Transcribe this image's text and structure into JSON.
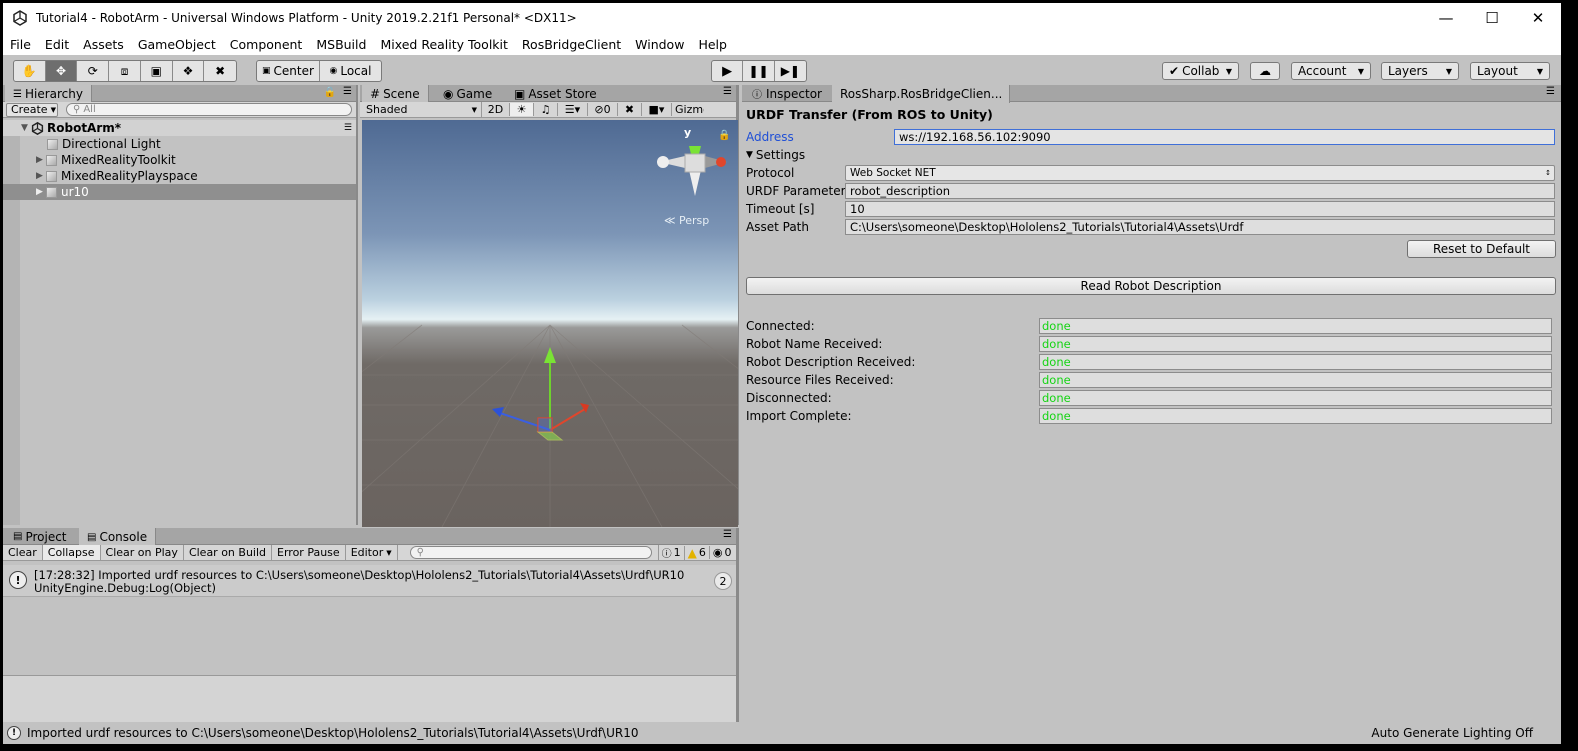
{
  "window": {
    "title": "Tutorial4 - RobotArm - Universal Windows Platform - Unity 2019.2.21f1 Personal* <DX11>"
  },
  "menu": [
    "File",
    "Edit",
    "Assets",
    "GameObject",
    "Component",
    "MSBuild",
    "Mixed Reality Toolkit",
    "RosBridgeClient",
    "Window",
    "Help"
  ],
  "toolbar": {
    "pivot": "Center",
    "space": "Local",
    "collab": "Collab",
    "account": "Account",
    "layers": "Layers",
    "layout": "Layout"
  },
  "hierarchy": {
    "tab": "Hierarchy",
    "create": "Create",
    "search_placeholder": "All",
    "scene": "RobotArm*",
    "items": [
      "Directional Light",
      "MixedRealityToolkit",
      "MixedRealityPlayspace",
      "ur10"
    ]
  },
  "scene_view": {
    "tabs": [
      "Scene",
      "Game",
      "Asset Store"
    ],
    "shading": "Shaded",
    "mode_2d": "2D",
    "fx_count": "0",
    "gizmos": "Gizmo",
    "gizmo_axis_y": "y",
    "persp": "Persp"
  },
  "inspector": {
    "tabs": [
      "Inspector",
      "RosSharp.RosBridgeClien..."
    ],
    "header": "URDF Transfer (From ROS to Unity)",
    "address_label": "Address",
    "address_value": "ws://192.168.56.102:9090",
    "settings_label": "Settings",
    "protocol_label": "Protocol",
    "protocol_value": "Web Socket NET",
    "urdf_param_label": "URDF Parameter",
    "urdf_param_value": "robot_description",
    "timeout_label": "Timeout [s]",
    "timeout_value": "10",
    "asset_path_label": "Asset Path",
    "asset_path_value": "C:\\Users\\someone\\Desktop\\Hololens2_Tutorials\\Tutorial4\\Assets\\Urdf",
    "reset_button": "Reset to Default",
    "read_button": "Read Robot Description",
    "status": [
      {
        "label": "Connected:",
        "value": "done"
      },
      {
        "label": "Robot Name Received:",
        "value": "done"
      },
      {
        "label": "Robot Description Received:",
        "value": "done"
      },
      {
        "label": "Resource Files Received:",
        "value": "done"
      },
      {
        "label": "Disconnected:",
        "value": "done"
      },
      {
        "label": "Import Complete:",
        "value": "done"
      }
    ]
  },
  "console": {
    "tabs": [
      "Project",
      "Console"
    ],
    "buttons": [
      "Clear",
      "Collapse",
      "Clear on Play",
      "Clear on Build",
      "Error Pause",
      "Editor"
    ],
    "info_count": "1",
    "warn_count": "6",
    "error_count": "0",
    "entry_line1": "[17:28:32] Imported urdf resources to C:\\Users\\someone\\Desktop\\Hololens2_Tutorials\\Tutorial4\\Assets\\Urdf\\UR10",
    "entry_line2": "UnityEngine.Debug:Log(Object)",
    "entry_count": "2"
  },
  "statusbar": {
    "message": "Imported urdf resources to C:\\Users\\someone\\Desktop\\Hololens2_Tutorials\\Tutorial4\\Assets\\Urdf\\UR10",
    "right": "Auto Generate Lighting Off"
  },
  "colors": {
    "done": "#16d414",
    "address": "#1f4fd6",
    "selected_row": "#8f8f8f"
  }
}
